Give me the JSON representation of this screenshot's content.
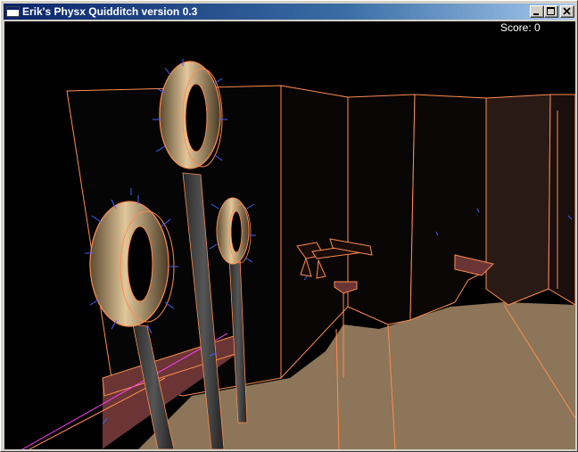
{
  "window": {
    "title": "Erik's Physx Quidditch version 0.3",
    "controls": [
      "minimize",
      "maximize",
      "close"
    ]
  },
  "hud": {
    "score_text": "Score: 0"
  },
  "colors": {
    "titlebar_start": "#0a246a",
    "titlebar_end": "#a6caf0",
    "viewport_background": "#000000",
    "wireframe": "#ff8c50",
    "ground": "#8c7558",
    "normals": "#4060ff",
    "ring_gold": "#c9a26a",
    "pole": "#3c3c3c",
    "bench": "#6b3535"
  },
  "icons": {
    "app": "app-window-icon",
    "minimize": "minimize-icon",
    "maximize": "maximize-icon",
    "close": "close-icon"
  }
}
